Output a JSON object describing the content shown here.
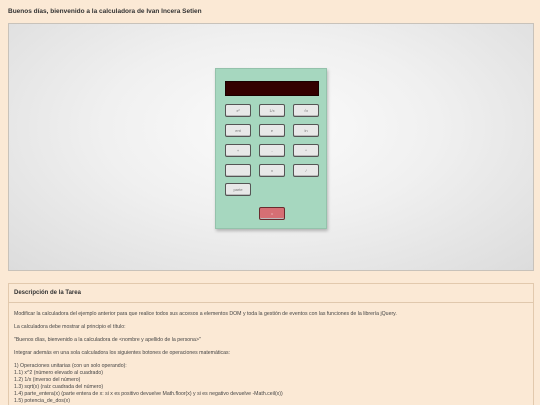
{
  "header": {
    "greeting": "Buenos días, bienvenido a la calculadora de Ivan Incera Setien"
  },
  "calculator": {
    "display_value": "",
    "keys": [
      "x²",
      "1/x",
      "√x",
      "ent",
      "e",
      "ln",
      "+",
      "-",
      "*",
      "",
      "x",
      "/",
      "parte",
      "="
    ]
  },
  "description": {
    "title": "Descripción de la Tarea",
    "p1": "Modificar la calculadora del ejemplo anterior para que realice todos sus accesos a elementos DOM y toda la gestión de eventos con las funciones de la librería jQuery.",
    "p2": "La calculadora debe mostrar al principio el título:",
    "p3": "\"Buenos días, bienvenido a la calculadora de <nombre y apellido de la persona>\"",
    "p4": "Integrar además en una sola calculadora los siguientes botones de operaciones matemáticas:",
    "list_intro": "1) Operaciones unitarias (con un solo operando):",
    "list": [
      "1.1) x^2 (número elevado al cuadrado)",
      "1.2) 1/x (inverso del número)",
      "1.3) sqrt(x) (raíz cuadrada del número)",
      "1.4) parte_entera(x) (parte entera de x: si x es positivo devuelve Math.floor(x) y si es negativo devuelve -Math.ceil(x))",
      "1.5) potencia_de_dos(x)"
    ]
  }
}
